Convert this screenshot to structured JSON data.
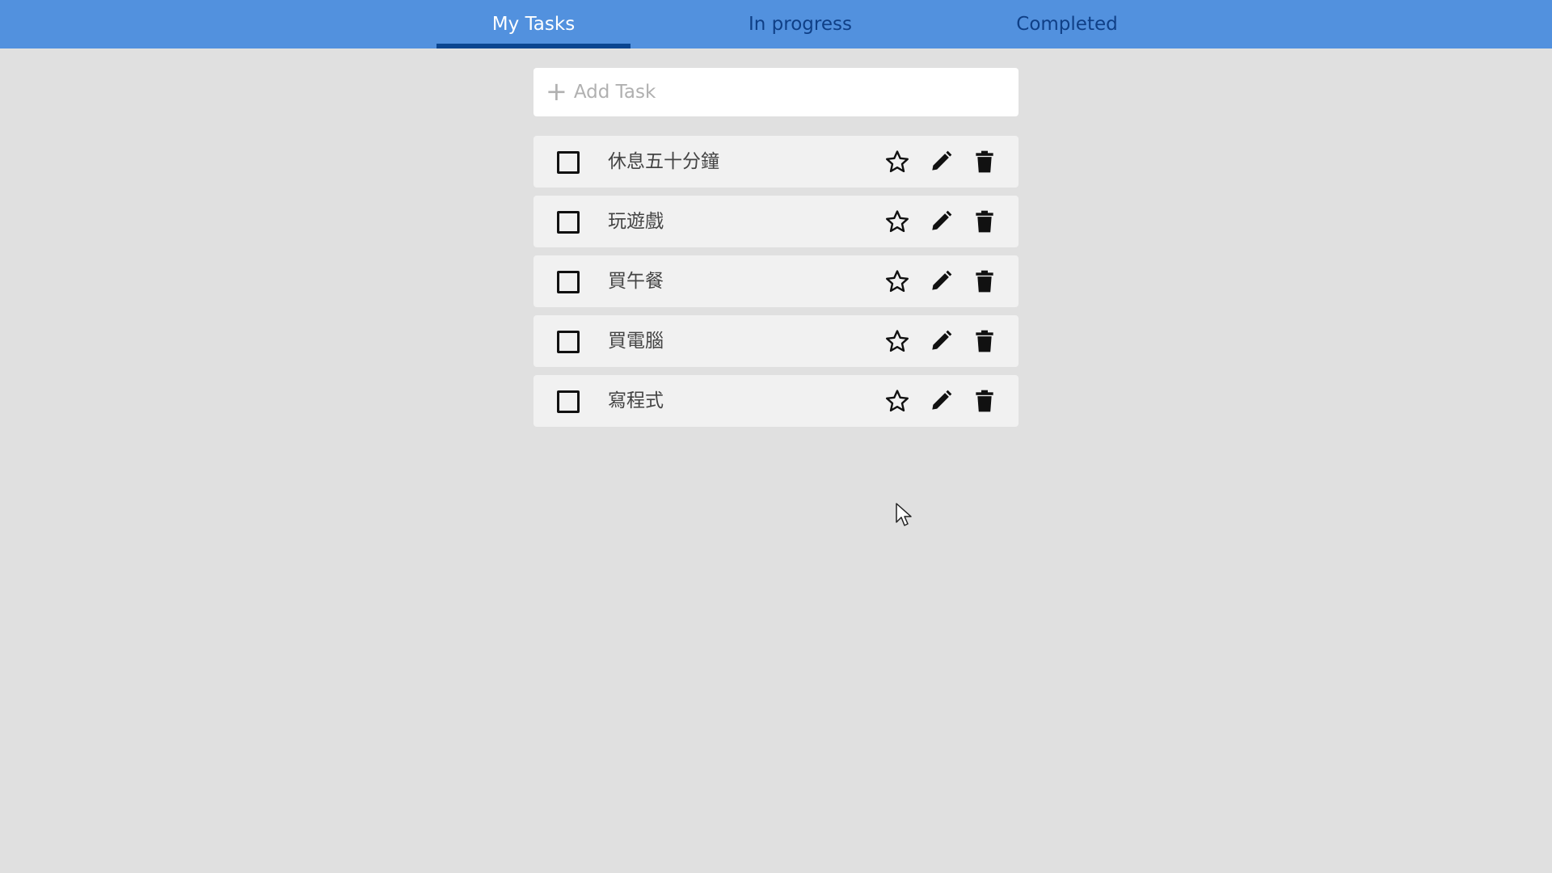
{
  "tabs": [
    {
      "label": "My Tasks",
      "active": true
    },
    {
      "label": "In progress",
      "active": false
    },
    {
      "label": "Completed",
      "active": false
    }
  ],
  "add_task": {
    "placeholder": "Add Task",
    "value": ""
  },
  "tasks": [
    {
      "title": "休息五十分鐘",
      "checked": false,
      "starred": false
    },
    {
      "title": "玩遊戲",
      "checked": false,
      "starred": false
    },
    {
      "title": "買午餐",
      "checked": false,
      "starred": false
    },
    {
      "title": "買電腦",
      "checked": false,
      "starred": false
    },
    {
      "title": "寫程式",
      "checked": false,
      "starred": false
    }
  ],
  "icons": {
    "add": "plus-icon",
    "star": "star-outline-icon",
    "edit": "pencil-icon",
    "delete": "trash-icon"
  },
  "colors": {
    "topbar": "#5291de",
    "tab_active_text": "#ffffff",
    "tab_inactive_text": "#0f3f86",
    "tab_underline": "#0a4590",
    "background": "#e0e0e0",
    "card": "#f1f1f1"
  }
}
